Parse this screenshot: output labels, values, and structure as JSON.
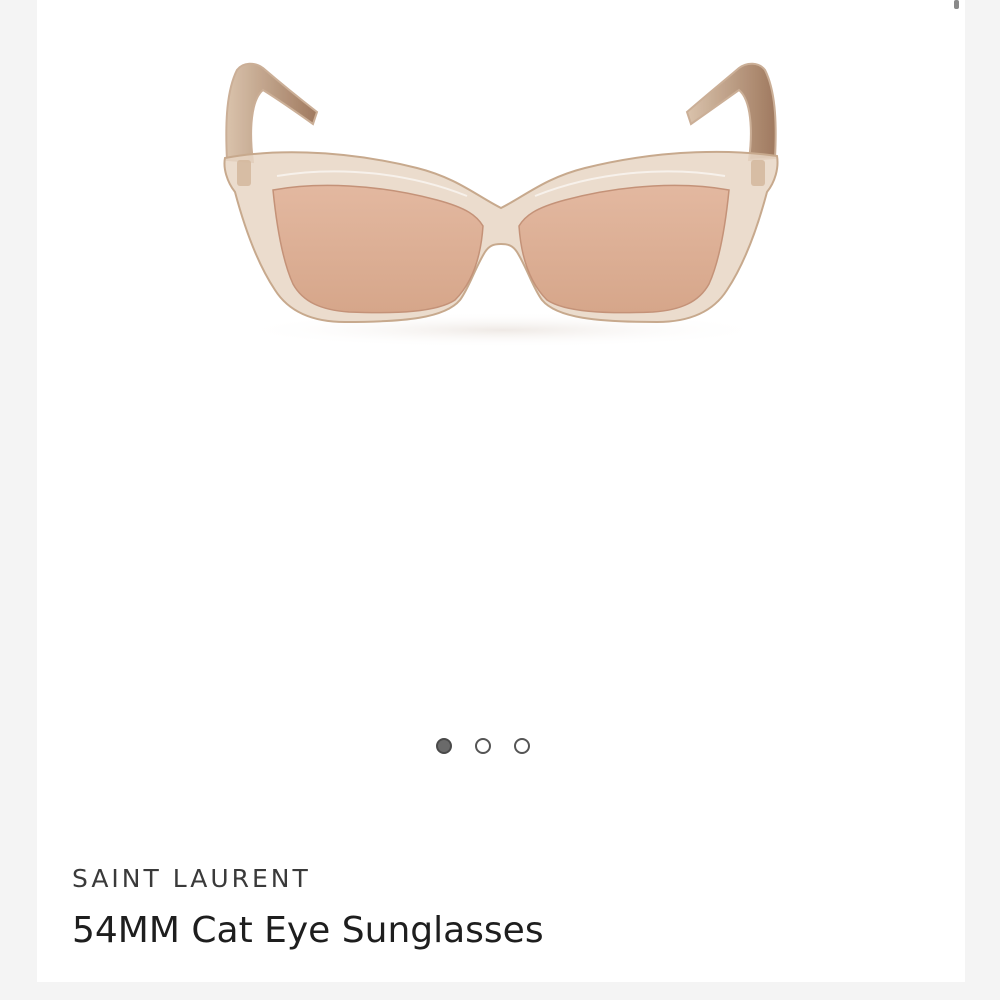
{
  "product": {
    "brand": "SAINT LAURENT",
    "title": "54MM Cat Eye Sunglasses",
    "image_icon": "cat-eye-sunglasses-image"
  },
  "gallery": {
    "total_images": 3,
    "active_index": 0
  },
  "colors": {
    "frame": "#e6d3c0",
    "lens": "#d9aa90",
    "temple": "#b58f72",
    "dot_active": "#6a6a6a"
  }
}
